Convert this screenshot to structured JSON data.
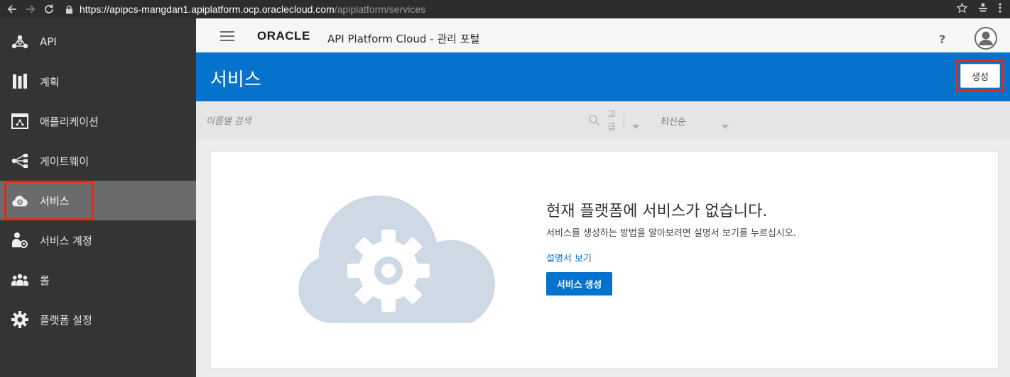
{
  "browser": {
    "url_host": "https://apipcs-mangdan1.apiplatform.ocp.oraclecloud.com",
    "url_path": "/apiplatform/services"
  },
  "sidebar": {
    "items": [
      {
        "label": "API",
        "icon": "api-nodes-icon"
      },
      {
        "label": "계획",
        "icon": "plan-icon"
      },
      {
        "label": "애플리케이션",
        "icon": "application-icon"
      },
      {
        "label": "게이트웨이",
        "icon": "gateway-icon"
      },
      {
        "label": "서비스",
        "icon": "cloud-gear-icon",
        "active": true
      },
      {
        "label": "서비스 계정",
        "icon": "service-account-icon"
      },
      {
        "label": "롤",
        "icon": "roles-icon"
      },
      {
        "label": "플랫폼 설정",
        "icon": "gear-icon"
      }
    ]
  },
  "header": {
    "logo": "ORACLE",
    "title": "API Platform Cloud - 관리 포털",
    "help": "?"
  },
  "page": {
    "title": "서비스",
    "create_label": "생성"
  },
  "filter": {
    "search_placeholder": "이름별 검색",
    "advanced_label": "고급",
    "sort_label": "최신순"
  },
  "empty_state": {
    "title": "현재 플랫폼에 서비스가 없습니다.",
    "description": "서비스를 생성하는 방법을 알아보려면 설명서 보기를 누르십시오.",
    "doc_link": "설명서 보기",
    "create_service_button": "서비스 생성"
  },
  "colors": {
    "accent": "#0572ce",
    "sidebar_bg": "#333436",
    "highlight": "#e02a1a",
    "cloud": "#cfd9e5"
  }
}
